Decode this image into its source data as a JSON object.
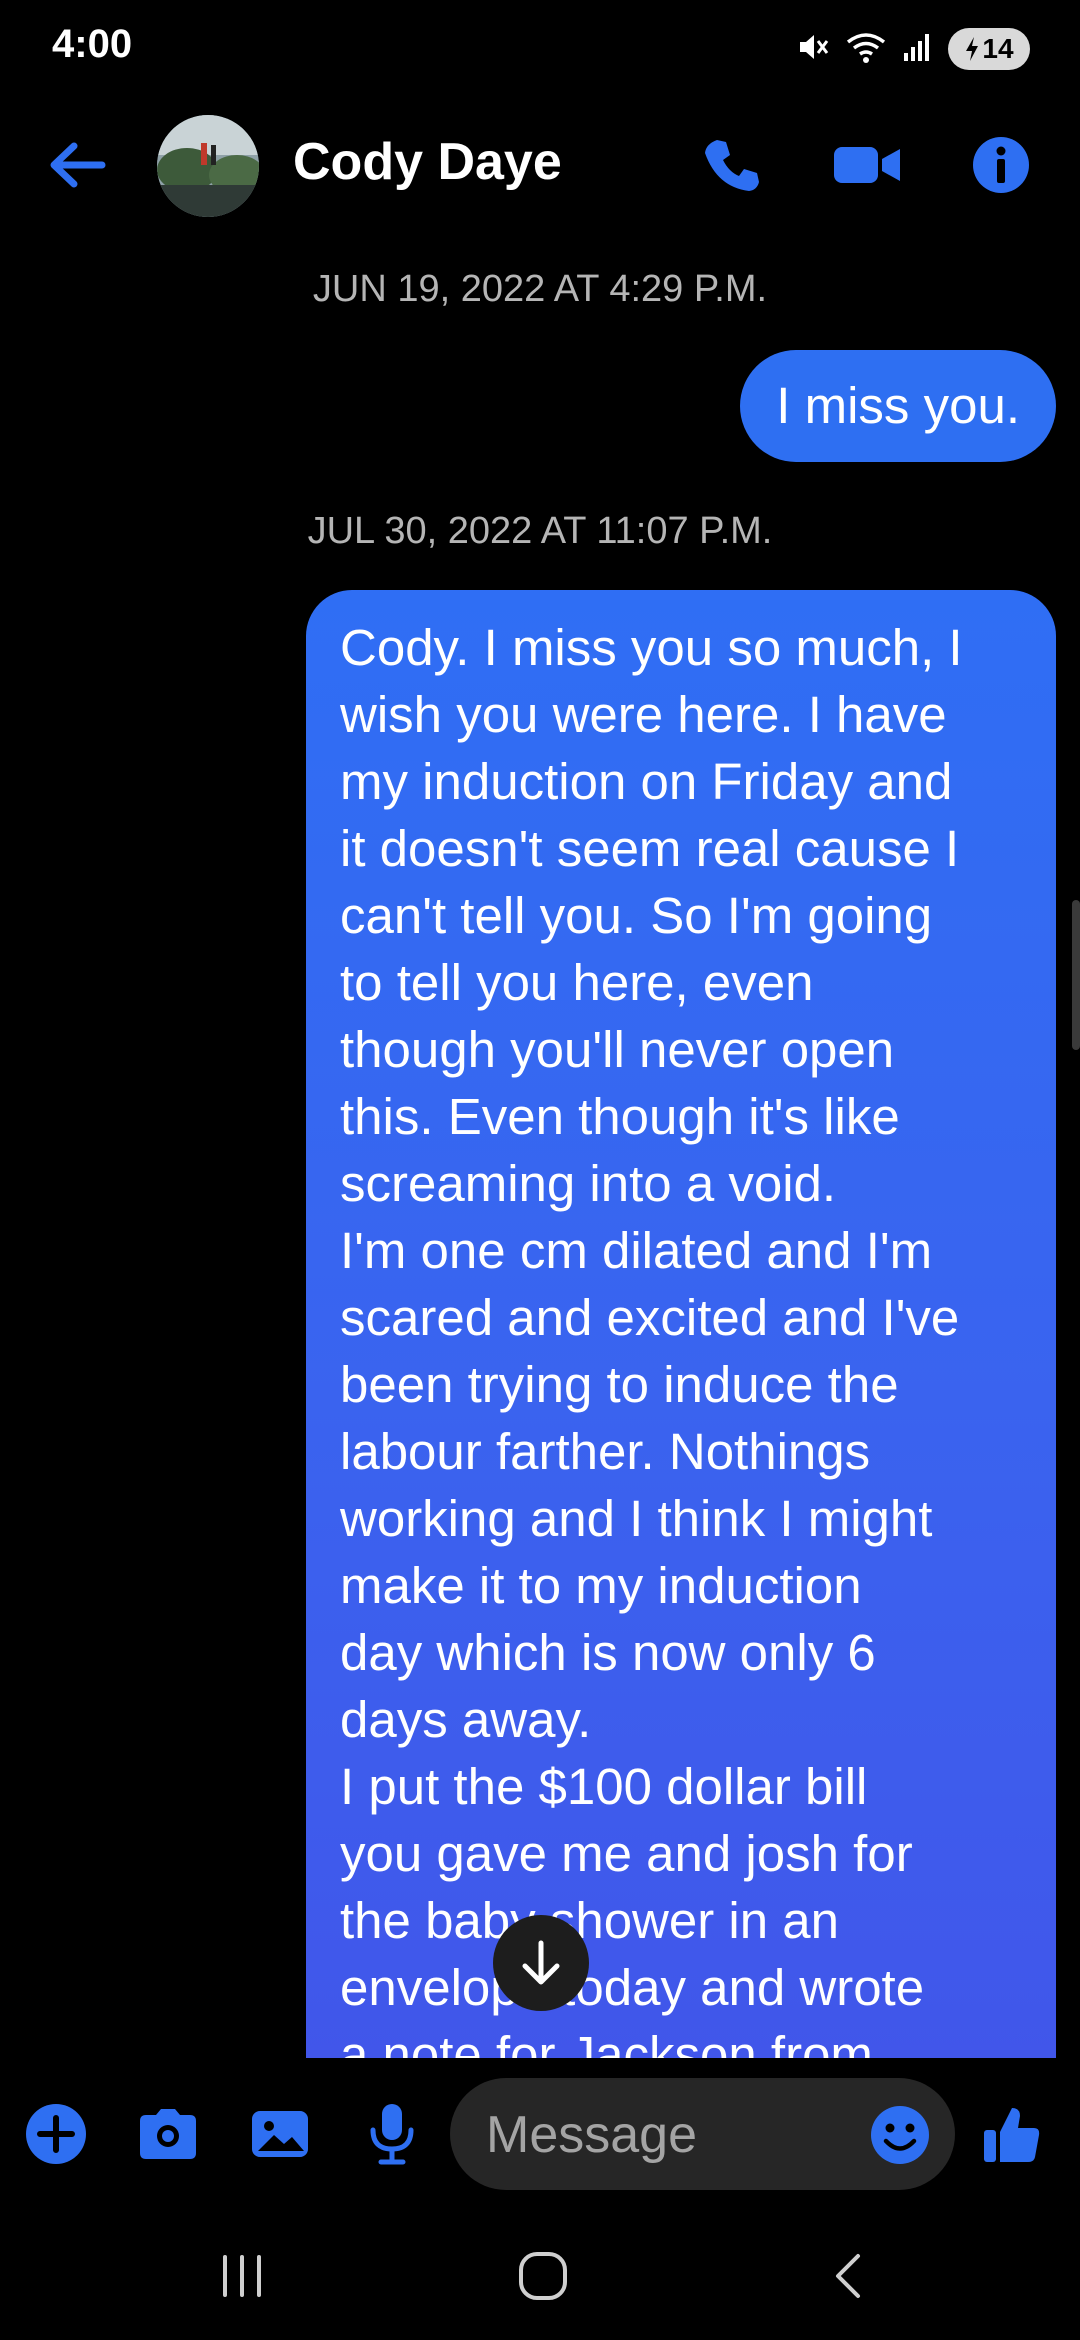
{
  "status_bar": {
    "time": "4:00",
    "battery": "14",
    "icons": [
      "mute-icon",
      "wifi-icon",
      "signal-icon",
      "battery-charging-icon"
    ]
  },
  "header": {
    "contact_name": "Cody Daye",
    "icons": [
      "back-arrow-icon",
      "phone-icon",
      "video-call-icon",
      "info-icon"
    ],
    "accent_color": "#2e6ff2"
  },
  "conversation": {
    "messages": [
      {
        "timestamp": "JUN 19, 2022 AT 4:29 P.M.",
        "text": "I miss you."
      },
      {
        "timestamp": "JUL 30, 2022 AT 11:07 P.M.",
        "text": "Cody. I miss you so much, I\nwish you were here. I have\nmy induction on Friday and\nit doesn't seem real cause I\ncan't tell you. So I'm going\nto tell you here, even\nthough you'll never open\nthis. Even though it's like\nscreaming into a void.\nI'm one cm dilated and I'm\nscared and excited and I've\nbeen trying to induce the\nlabour farther. Nothings\nworking and I think I might\nmake it to my induction\nday which is now only 6\ndays away.\nI put the $100 dollar bill\nyou gave me and josh for\nthe baby shower in an\nenvelope today and wrote\na note for Jackson from"
      }
    ],
    "bubble_color": "#2e6ff2"
  },
  "composer": {
    "placeholder": "Message",
    "icons": [
      "plus-icon",
      "camera-icon",
      "gallery-icon",
      "microphone-icon",
      "emoji-icon",
      "thumbs-up-icon"
    ]
  },
  "nav_bar": {
    "icons": [
      "recent-apps-icon",
      "home-icon",
      "back-icon"
    ]
  }
}
